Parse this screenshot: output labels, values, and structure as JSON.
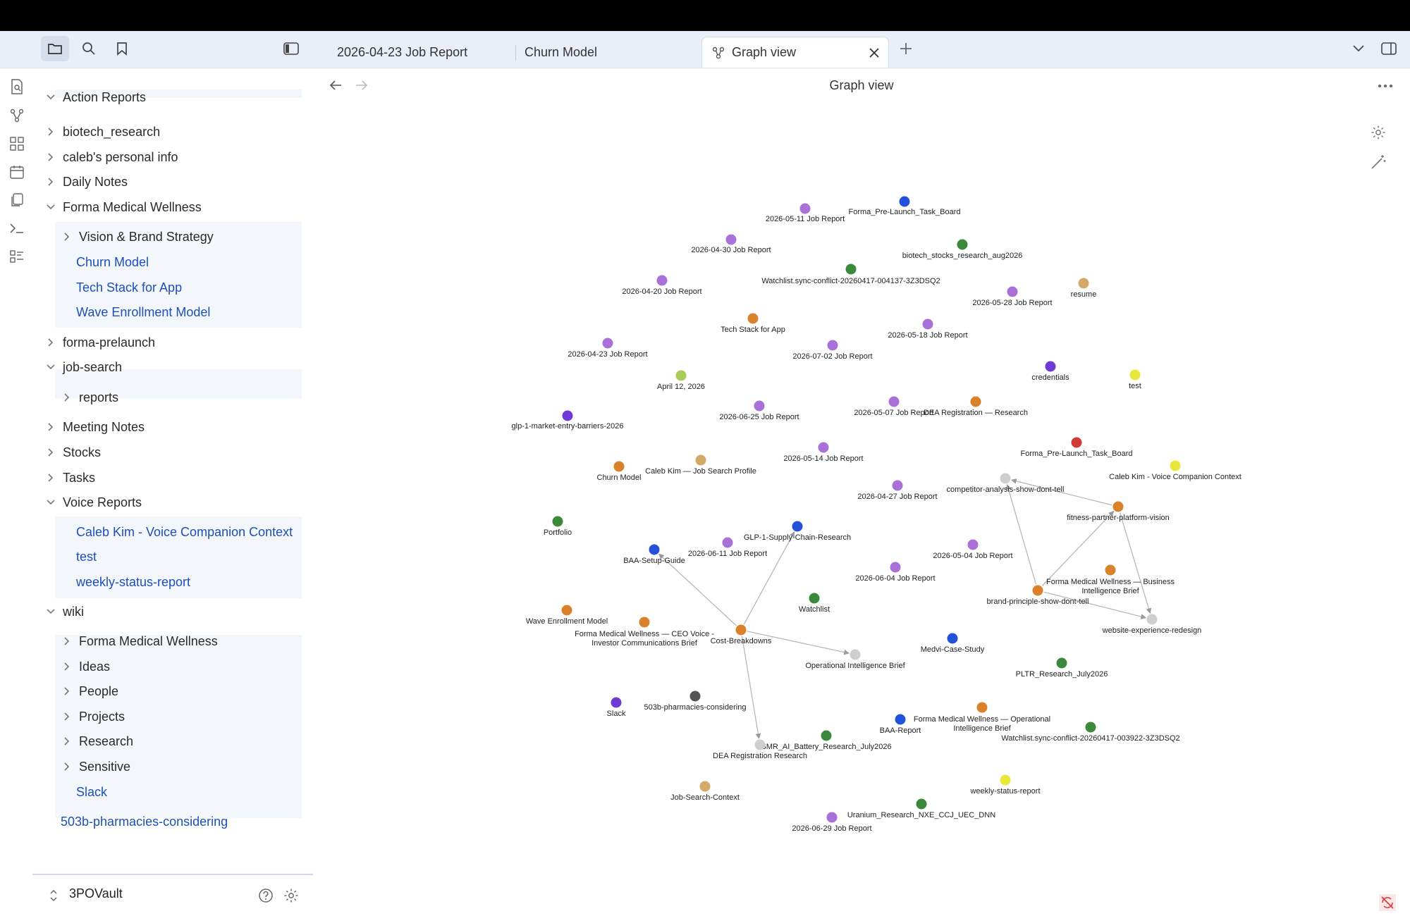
{
  "tabs": [
    {
      "label": "2026-04-23 Job Report"
    },
    {
      "label": "Churn Model"
    },
    {
      "label": "Graph view"
    }
  ],
  "view": {
    "title": "Graph view"
  },
  "sidebar": {
    "rows": [
      {
        "label": "Action Reports",
        "type": "folder",
        "open": true
      },
      {
        "label": "biotech_research",
        "type": "folder",
        "open": false
      },
      {
        "label": "caleb's personal info",
        "type": "folder",
        "open": false
      },
      {
        "label": "Daily Notes",
        "type": "folder",
        "open": false
      },
      {
        "label": "Forma Medical Wellness",
        "type": "folder",
        "open": true
      },
      {
        "label": "Vision & Brand Strategy",
        "type": "folder",
        "open": false
      },
      {
        "label": "Churn Model",
        "type": "file"
      },
      {
        "label": "Tech Stack for App",
        "type": "file"
      },
      {
        "label": "Wave Enrollment Model",
        "type": "file"
      },
      {
        "label": "forma-prelaunch",
        "type": "folder",
        "open": false
      },
      {
        "label": "job-search",
        "type": "folder",
        "open": true
      },
      {
        "label": "reports",
        "type": "folder",
        "open": false
      },
      {
        "label": "Meeting Notes",
        "type": "folder",
        "open": false
      },
      {
        "label": "Stocks",
        "type": "folder",
        "open": false
      },
      {
        "label": "Tasks",
        "type": "folder",
        "open": false
      },
      {
        "label": "Voice Reports",
        "type": "folder",
        "open": true
      },
      {
        "label": "Caleb Kim - Voice Companion Context",
        "type": "file"
      },
      {
        "label": "test",
        "type": "file"
      },
      {
        "label": "weekly-status-report",
        "type": "file"
      },
      {
        "label": "wiki",
        "type": "folder",
        "open": true
      },
      {
        "label": "Forma Medical Wellness",
        "type": "folder",
        "open": false
      },
      {
        "label": "Ideas",
        "type": "folder",
        "open": false
      },
      {
        "label": "People",
        "type": "folder",
        "open": false
      },
      {
        "label": "Projects",
        "type": "folder",
        "open": false
      },
      {
        "label": "Research",
        "type": "folder",
        "open": false
      },
      {
        "label": "Sensitive",
        "type": "folder",
        "open": false
      },
      {
        "label": "Slack",
        "type": "file"
      },
      {
        "label": "503b-pharmacies-considering",
        "type": "file"
      }
    ]
  },
  "vault": {
    "name": "3POVault"
  },
  "colors": {
    "purple": "#a970d8",
    "blue": "#2451d9",
    "green": "#3b8a3b",
    "orange": "#d9822b",
    "tan": "#d2a966",
    "lime": "#a7cc5a",
    "violet": "#6f3ad6",
    "red": "#d23a3a",
    "yellow": "#e9e83a",
    "gray": "#cfcfcf",
    "dark": "#555555"
  },
  "graph": {
    "nodes": [
      {
        "label": "2026-05-11 Job Report",
        "color": "purple"
      },
      {
        "label": "Forma_Pre-Launch_Task_Board",
        "color": "blue"
      },
      {
        "label": "2026-04-30 Job Report",
        "color": "purple"
      },
      {
        "label": "biotech_stocks_research_aug2026",
        "color": "green"
      },
      {
        "label": "Watchlist.sync-conflict-20260417-004137-3Z3DSQ2",
        "color": "green"
      },
      {
        "label": "2026-04-20 Job Report",
        "color": "purple"
      },
      {
        "label": "resume",
        "color": "tan"
      },
      {
        "label": "2026-05-28 Job Report",
        "color": "purple"
      },
      {
        "label": "Tech Stack for App",
        "color": "orange"
      },
      {
        "label": "2026-05-18 Job Report",
        "color": "purple"
      },
      {
        "label": "2026-04-23 Job Report",
        "color": "purple"
      },
      {
        "label": "2026-07-02 Job Report",
        "color": "purple"
      },
      {
        "label": "credentials",
        "color": "violet"
      },
      {
        "label": "April 12, 2026",
        "color": "lime"
      },
      {
        "label": "test",
        "color": "yellow"
      },
      {
        "label": "glp-1-market-entry-barriers-2026",
        "color": "violet"
      },
      {
        "label": "2026-06-25 Job Report",
        "color": "purple"
      },
      {
        "label": "2026-05-07 Job Report",
        "color": "purple"
      },
      {
        "label": "DEA Registration — Research",
        "color": "orange"
      },
      {
        "label": "Forma_Pre-Launch_Task_Board",
        "color": "red"
      },
      {
        "label": "2026-05-14 Job Report",
        "color": "purple"
      },
      {
        "label": "Churn Model",
        "color": "orange"
      },
      {
        "label": "Caleb Kim — Job Search Profile",
        "color": "tan"
      },
      {
        "label": "Caleb Kim - Voice Companion Context",
        "color": "yellow"
      },
      {
        "label": "competitor-analysis-show-dont-tell",
        "color": "gray"
      },
      {
        "label": "2026-04-27 Job Report",
        "color": "purple"
      },
      {
        "label": "fitness-partner-platform-vision",
        "color": "orange"
      },
      {
        "label": "Portfolio",
        "color": "green"
      },
      {
        "label": "GLP-1-Supply-Chain-Research",
        "color": "blue"
      },
      {
        "label": "BAA-Setup-Guide",
        "color": "blue"
      },
      {
        "label": "2026-06-11 Job Report",
        "color": "purple"
      },
      {
        "label": "2026-05-04 Job Report",
        "color": "purple"
      },
      {
        "label": "Forma Medical Wellness — Business Intelligence Brief",
        "color": "orange"
      },
      {
        "label": "2026-06-04 Job Report",
        "color": "purple"
      },
      {
        "label": "brand-principle-show-dont-tell",
        "color": "orange"
      },
      {
        "label": "website-experience-redesign",
        "color": "gray"
      },
      {
        "label": "Watchlist",
        "color": "green"
      },
      {
        "label": "Wave Enrollment Model",
        "color": "orange"
      },
      {
        "label": "Forma Medical Wellness — CEO Voice - Investor Communications Brief",
        "color": "orange"
      },
      {
        "label": "Cost-Breakdowns",
        "color": "orange"
      },
      {
        "label": "Operational Intelligence Brief",
        "color": "gray"
      },
      {
        "label": "Medvi-Case-Study",
        "color": "blue"
      },
      {
        "label": "PLTR_Research_July2026",
        "color": "green"
      },
      {
        "label": "Slack",
        "color": "violet"
      },
      {
        "label": "503b-pharmacies-considering",
        "color": "dark"
      },
      {
        "label": "Forma Medical Wellness — Operational Intelligence Brief",
        "color": "orange"
      },
      {
        "label": "BAA-Report",
        "color": "blue"
      },
      {
        "label": "Watchlist.sync-conflict-20260417-003922-3Z3DSQ2",
        "color": "green"
      },
      {
        "label": "SMR_AI_Battery_Research_July2026",
        "color": "green"
      },
      {
        "label": "DEA Registration Research",
        "color": "gray"
      },
      {
        "label": "weekly-status-report",
        "color": "yellow"
      },
      {
        "label": "Job-Search-Context",
        "color": "tan"
      },
      {
        "label": "Uranium_Research_NXE_CCJ_UEC_DNN",
        "color": "green"
      },
      {
        "label": "2026-06-29 Job Report",
        "color": "purple"
      }
    ]
  }
}
